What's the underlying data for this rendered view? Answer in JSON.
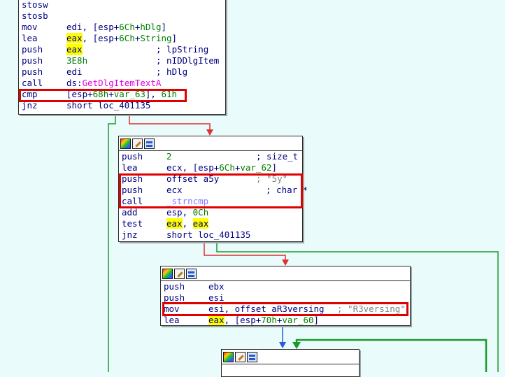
{
  "block1": {
    "lines": [
      {
        "mnemonic": "stosw"
      },
      {
        "mnemonic": "stosb"
      },
      {
        "mnemonic": "mov",
        "operand": "edi, [esp+",
        "op_sym": "6Ch",
        "op_plus": "+",
        "op_sym2": "hDlg",
        "op_end": "]"
      },
      {
        "mnemonic": "lea",
        "operand_hl": "eax",
        "operand": ", [esp+",
        "op_sym": "6Ch",
        "op_plus": "+",
        "op_sym2": "String",
        "op_end": "]"
      },
      {
        "mnemonic": "push",
        "operand_hl": "eax",
        "comment": "; lpString"
      },
      {
        "mnemonic": "push",
        "operand_num": "3E8h",
        "comment": "; nIDDlgItem"
      },
      {
        "mnemonic": "push",
        "operand": "edi",
        "comment": "; hDlg"
      },
      {
        "mnemonic": "call",
        "operand": "ds:",
        "op_fn": "GetDlgItemTextA"
      },
      {
        "mnemonic": "cmp",
        "operand": "[esp+",
        "op_sym": "68h",
        "op_plus": "+",
        "op_sym2": "var_63",
        "op_end": "], ",
        "op_num": "61h"
      },
      {
        "mnemonic": "jnz",
        "operand": "short loc_401135"
      }
    ]
  },
  "block2": {
    "lines": [
      {
        "mnemonic": "push",
        "operand_num": "2",
        "comment": "; size_t"
      },
      {
        "mnemonic": "lea",
        "operand": "ecx, [esp+",
        "op_sym": "6Ch",
        "op_plus": "+",
        "op_sym2": "var_62",
        "op_end": "]"
      },
      {
        "mnemonic": "push",
        "operand": "offset a5y",
        "comment": ";",
        "str_comment": " \"5y\""
      },
      {
        "mnemonic": "push",
        "operand": "ecx",
        "comment": "; char *"
      },
      {
        "mnemonic": "call",
        "op_fn2": "_strncmp"
      },
      {
        "mnemonic": "add",
        "operand": "esp, ",
        "op_num": "0Ch"
      },
      {
        "mnemonic": "test",
        "operand_hl": "eax",
        "operand": ", ",
        "operand_hl2": "eax"
      },
      {
        "mnemonic": "jnz",
        "operand": "short loc_401135"
      }
    ]
  },
  "block3": {
    "lines": [
      {
        "mnemonic": "push",
        "operand": "ebx"
      },
      {
        "mnemonic": "push",
        "operand": "esi"
      },
      {
        "mnemonic": "mov",
        "operand": "esi, offset aR3versing",
        "comment": ";",
        "str_comment": " \"R3versing\""
      },
      {
        "mnemonic": "lea",
        "operand_hl": "eax",
        "operand": ", [esp+",
        "op_sym": "70h",
        "op_plus": "+",
        "op_sym2": "var_60",
        "op_end": "]"
      }
    ]
  },
  "colors": {
    "background": "#e9fbfb",
    "edge_false": "#e03030",
    "edge_true": "#1a9a2a",
    "edge_uncond": "#2a58e0",
    "highlight_box": "#e00000"
  }
}
